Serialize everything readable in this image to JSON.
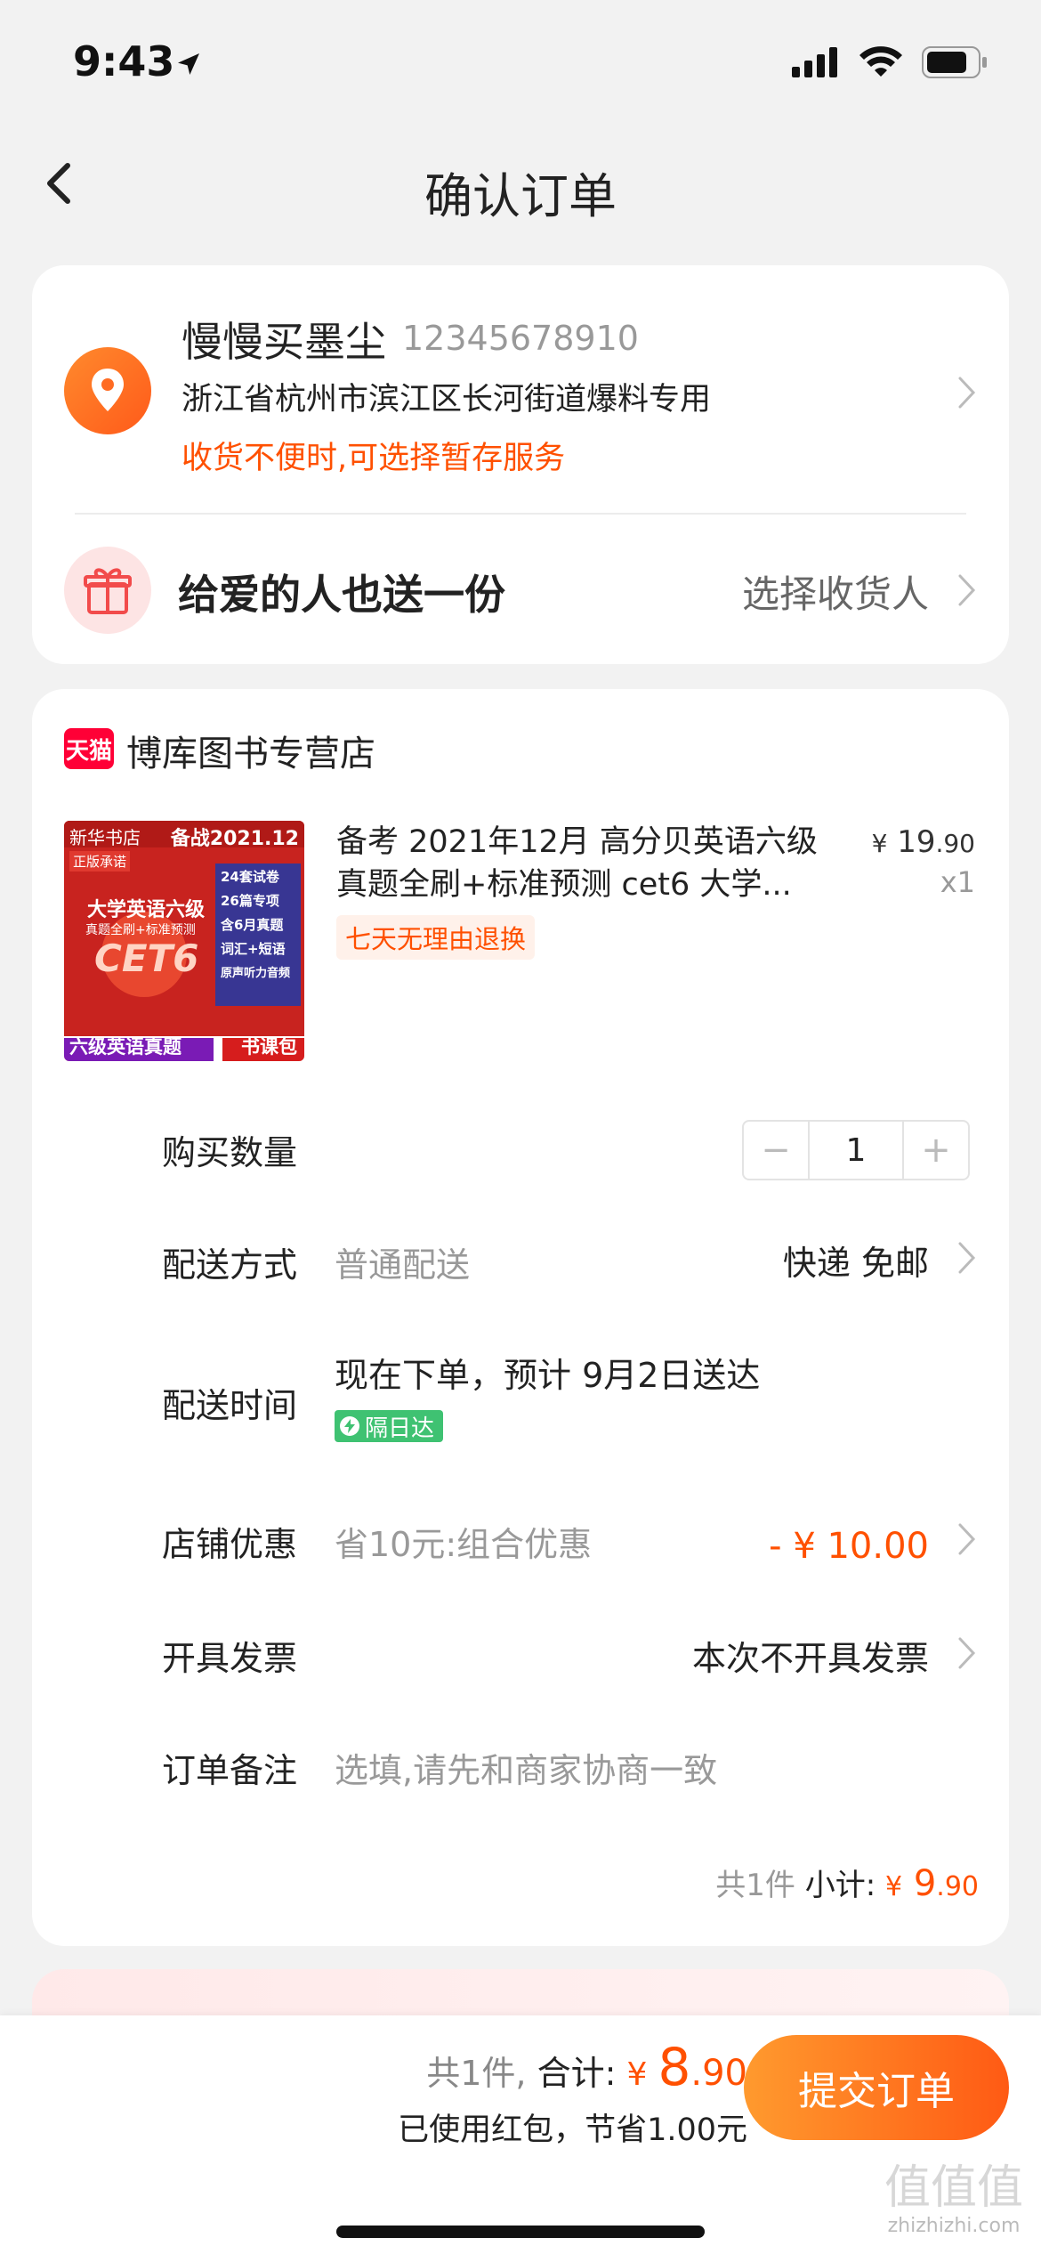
{
  "status_bar": {
    "time": "9:43"
  },
  "nav": {
    "title": "确认订单"
  },
  "address": {
    "name": "慢慢买墨尘",
    "phone": "12345678910",
    "line": "浙江省杭州市滨江区长河街道爆料专用",
    "tip": "收货不便时,可选择暂存服务"
  },
  "gift": {
    "title": "给爱的人也送一份",
    "choose_label": "选择收货人"
  },
  "shop": {
    "badge": "天猫",
    "name": "博库图书专营店"
  },
  "product": {
    "title": "备考 2021年12月 高分贝英语六级真题全刷+标准预测 cet6 大学...",
    "price_currency": "¥",
    "price_int": "19",
    "price_dec": ".90",
    "qty": "x1",
    "return_tag": "七天无理由退换",
    "image_text": {
      "brand": "新华书店",
      "top_right": "备战2021.12",
      "stamp": "正版承诺",
      "title1": "大学英语六级",
      "title2": "真题全刷+标准预测",
      "big": "CET6",
      "side": [
        "24套试卷",
        "26篇专项",
        "含6月真题",
        "词汇+短语",
        "原声听力音频"
      ],
      "bottom_left": "六级英语真题",
      "bottom_right": "书课包"
    }
  },
  "rows": {
    "quantity_label": "购买数量",
    "quantity_value": "1",
    "minus": "−",
    "plus": "+",
    "delivery_label": "配送方式",
    "delivery_type": "普通配送",
    "delivery_value": "快递 免邮",
    "time_label": "配送时间",
    "time_value": "现在下单，预计 9月2日送达",
    "time_tag": "隔日达",
    "coupon_label": "店铺优惠",
    "coupon_desc": "省10元:组合优惠",
    "coupon_value": "- ¥ 10.00",
    "invoice_label": "开具发票",
    "invoice_value": "本次不开具发票",
    "note_label": "订单备注",
    "note_placeholder": "选填,请先和商家协商一致"
  },
  "subtotal": {
    "count": "共1件",
    "label": "小计:",
    "currency": "¥",
    "int": "9",
    "dec": ".90"
  },
  "bottom": {
    "count": "共1件,",
    "label": "合计:",
    "currency": "¥",
    "int": "8",
    "dec": ".90",
    "saved": "已使用红包，节省1.00元",
    "submit": "提交订单"
  },
  "watermark": {
    "title": "值值值",
    "sub": "zhizhizhi.com"
  },
  "colors": {
    "accent": "#ff5000",
    "button_start": "#ff9a2e",
    "button_end": "#ff5a14",
    "tmall": "#ff0036"
  }
}
